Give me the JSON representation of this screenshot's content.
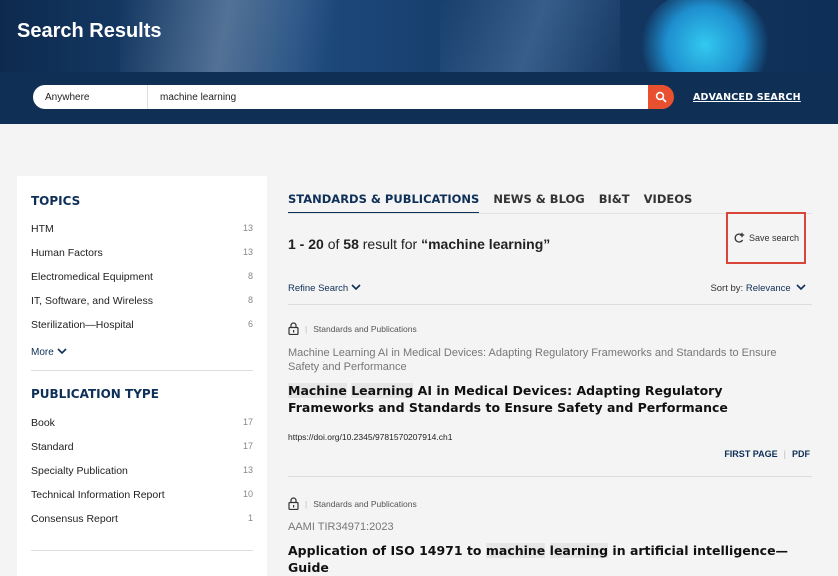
{
  "header": {
    "title": "Search Results"
  },
  "search": {
    "scope": "Anywhere",
    "query": "machine learning",
    "advanced_label": "ADVANCED SEARCH"
  },
  "topics": {
    "title": "TOPICS",
    "items": [
      {
        "label": "HTM",
        "count": "13"
      },
      {
        "label": "Human Factors",
        "count": "13"
      },
      {
        "label": "Electromedical Equipment",
        "count": "8"
      },
      {
        "label": "IT, Software, and Wireless",
        "count": "8"
      },
      {
        "label": "Sterilization—Hospital",
        "count": "6"
      }
    ],
    "more_label": "More"
  },
  "publication_type": {
    "title": "PUBLICATION TYPE",
    "items": [
      {
        "label": "Book",
        "count": "17"
      },
      {
        "label": "Standard",
        "count": "17"
      },
      {
        "label": "Specialty Publication",
        "count": "13"
      },
      {
        "label": "Technical Information Report",
        "count": "10"
      },
      {
        "label": "Consensus Report",
        "count": "1"
      }
    ]
  },
  "tabs": [
    "STANDARDS & PUBLICATIONS",
    "NEWS & BLOG",
    "BI&T",
    "VIDEOS"
  ],
  "results_summary": {
    "range": "1 - 20",
    "of": "of",
    "total": "58",
    "result_for": "result for",
    "query": "“machine learning”"
  },
  "save_search_label": "Save search",
  "refine_label": "Refine Search",
  "sort": {
    "label": "Sort by:",
    "value": "Relevance"
  },
  "results": [
    {
      "category": "Standards and Publications",
      "subtitle": "Machine Learning AI in Medical Devices: Adapting Regulatory Frameworks and Standards to Ensure Safety and Performance",
      "title_hl1": "Machine",
      "title_hl2": "Learning",
      "title_rest": " AI in Medical Devices: Adapting Regulatory Frameworks and Standards to Ensure Safety and Performance",
      "doi": "https://doi.org/10.2345/9781570207914.ch1",
      "link1": "FIRST PAGE",
      "link2": "PDF"
    },
    {
      "category": "Standards and Publications",
      "subtitle": "AAMI TIR34971:2023",
      "title_pre": "Application of ISO 14971 to ",
      "title_hl1": "machine",
      "title_hl2": "learning",
      "title_rest": " in artificial intelligence—Guide"
    }
  ]
}
